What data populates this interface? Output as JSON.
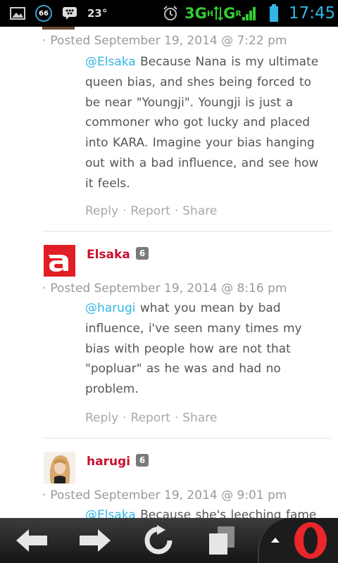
{
  "status_bar": {
    "notification_count": "66",
    "temperature": "23°",
    "network": "3G",
    "network_sup_1": "H",
    "network_2": "G",
    "network_sup_2": "R",
    "time": "17:45"
  },
  "comments": [
    {
      "meta_prefix": "·",
      "meta": "Posted September 19, 2014 @ 7:22 pm",
      "mention": "@Elsaka",
      "text": " Because Nana is my ultimate queen bias, and shes being forced to be near \"Youngji\". Youngji is just a commoner who got lucky and placed into KARA. Imagine your bias hanging out with a bad influence, and see how it feels.",
      "actions": [
        "Reply",
        "Report",
        "Share"
      ]
    },
    {
      "username": "Elsaka",
      "badge": "6",
      "meta_prefix": "·",
      "meta": "Posted September 19, 2014 @ 8:16 pm",
      "mention": "@harugi",
      "text": " what you mean by bad influence, i've seen many times my bias with people how are not that \"popluar\" as he was and had no problem.",
      "actions": [
        "Reply",
        "Report",
        "Share"
      ]
    },
    {
      "username": "harugi",
      "badge": "6",
      "meta_prefix": "·",
      "meta": "Posted September 19, 2014 @ 9:01 pm",
      "mention": "@Elsaka",
      "text": " Because she's leeching fame"
    }
  ],
  "action_separator": "·",
  "colors": {
    "mention": "#33b5e5",
    "username": "#c8102e",
    "time": "#33b5e5",
    "network": "#33cc33"
  },
  "toolbar": {
    "icons": [
      "back-arrow-icon",
      "forward-arrow-icon",
      "reload-icon",
      "tabs-icon",
      "menu-up-icon",
      "opera-logo-icon"
    ]
  }
}
